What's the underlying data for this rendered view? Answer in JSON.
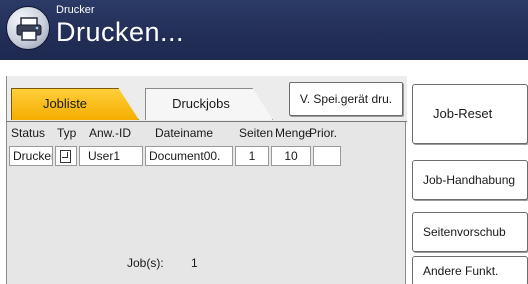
{
  "header": {
    "subtitle": "Drucker",
    "title": "Drucken..."
  },
  "tabs": [
    {
      "label": "Jobliste",
      "active": true
    },
    {
      "label": "Druckjobs",
      "active": false
    }
  ],
  "storage_button": "V. Spei.gerät dru.",
  "table": {
    "headers": [
      "Status",
      "Typ",
      "Anw.-ID",
      "Dateiname",
      "Seiten",
      "Menge",
      "Prior."
    ],
    "rows": [
      {
        "status": "Drucken",
        "type_icon": "document-icon",
        "user": "User1",
        "filename": "Document00.",
        "pages": "1",
        "quantity": "10",
        "priority": ""
      }
    ]
  },
  "footer": {
    "jobs_label": "Job(s):",
    "jobs_count": "1"
  },
  "side_buttons": {
    "reset": "Job-Reset",
    "handling": "Job-Handhabung",
    "feed": "Seitenvorschub",
    "other": "Andere Funkt."
  },
  "colors": {
    "header_bg": "#232f58",
    "active_tab": "#f5ad00",
    "panel_bg": "#e6e6e6"
  }
}
